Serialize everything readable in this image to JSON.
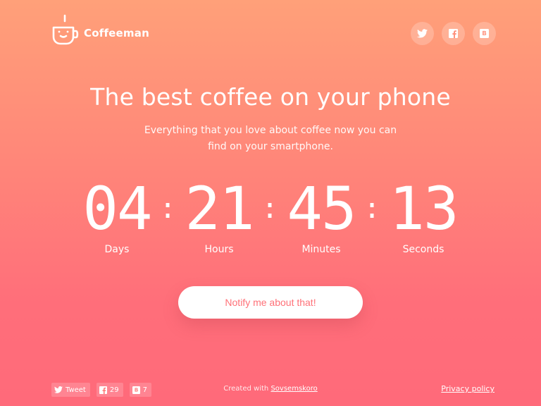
{
  "header": {
    "brand": "Coffeeman",
    "social": [
      {
        "icon": "twitter-icon"
      },
      {
        "icon": "facebook-icon"
      },
      {
        "icon": "vk-icon"
      }
    ]
  },
  "hero": {
    "title": "The best coffee on your phone",
    "subtitle_line1": "Everything that you love about coffee now you can",
    "subtitle_line2": "find on your smartphone."
  },
  "countdown": {
    "days": "04",
    "hours": "21",
    "minutes": "45",
    "seconds": "13",
    "labels": {
      "days": "Days",
      "hours": "Hours",
      "minutes": "Minutes",
      "seconds": "Seconds"
    },
    "separator": ":"
  },
  "cta": {
    "label": "Notify me about that!"
  },
  "footer": {
    "share": {
      "tweet_label": "Tweet",
      "facebook_count": "29",
      "vk_count": "7"
    },
    "credit_prefix": "Created with",
    "credit_link": "Sovsemskoro",
    "privacy": "Privacy policy"
  },
  "colors": {
    "gradient_top": "#ffa079",
    "gradient_bottom": "#ff6a7a",
    "cta_text": "#ff7178"
  }
}
